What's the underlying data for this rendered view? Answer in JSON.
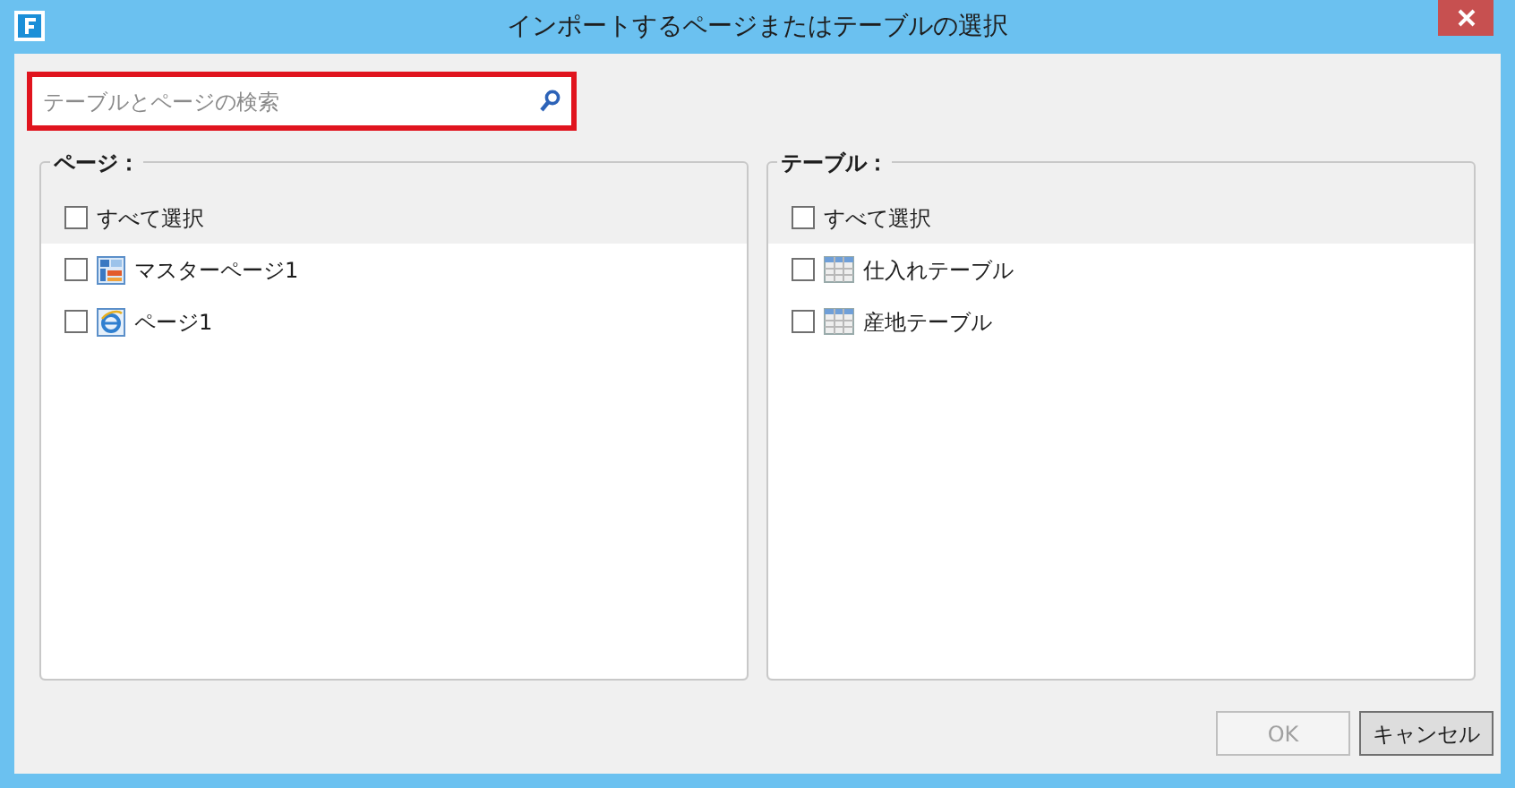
{
  "window": {
    "title": "インポートするページまたはテーブルの選択"
  },
  "search": {
    "placeholder": "テーブルとページの検索"
  },
  "panels": [
    {
      "label": "ページ：",
      "select_all": {
        "label": "すべて選択",
        "checked": false
      },
      "items": [
        {
          "label": "マスターページ1",
          "kind": "master_page",
          "checked": false
        },
        {
          "label": "ページ1",
          "kind": "page",
          "checked": false
        }
      ]
    },
    {
      "label": "テーブル：",
      "select_all": {
        "label": "すべて選択",
        "checked": false
      },
      "items": [
        {
          "label": "仕入れテーブル",
          "kind": "table",
          "checked": false
        },
        {
          "label": "産地テーブル",
          "kind": "table",
          "checked": false
        }
      ]
    }
  ],
  "buttons": [
    {
      "label": "OK",
      "disabled": true
    },
    {
      "label": "キャンセル",
      "disabled": false
    }
  ]
}
